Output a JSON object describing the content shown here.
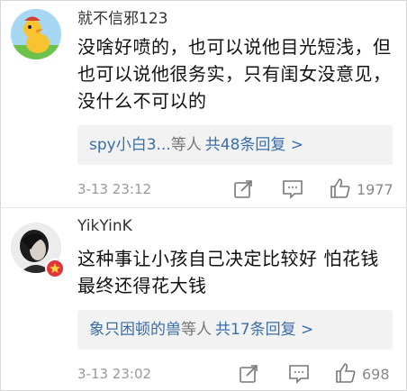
{
  "comments": [
    {
      "username": "就不信邪123",
      "text": "没啥好喷的，也可以说他目光短浅，但也可以说他很务实，只有闺女没意见，没什么不可以的",
      "reply_users": "spy小白3...",
      "reply_etc": "等人",
      "reply_count": "共48条回复 >",
      "time": "3-13 23:12",
      "likes": "1977"
    },
    {
      "username": "YikYinK",
      "text": "这种事让小孩自己决定比较好 怕花钱最终还得花大钱",
      "reply_users": "象只困顿的兽",
      "reply_etc": "等人",
      "reply_count": "共17条回复 >",
      "time": "3-13 23:02",
      "likes": "698"
    }
  ],
  "icons": {
    "share": "share-icon",
    "comment": "comment-icon",
    "like": "thumbs-up-icon",
    "badge": "verified-badge-icon"
  },
  "colors": {
    "link": "#3a6ea8",
    "reply_bg": "#f2f2f2",
    "badge": "#e0353a"
  }
}
